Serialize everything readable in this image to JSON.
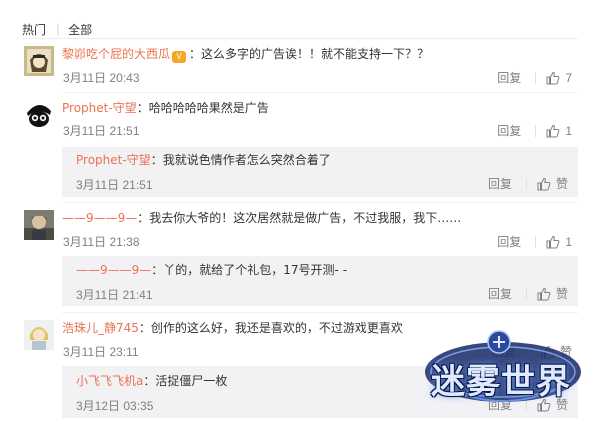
{
  "tabs": {
    "hot": "热门",
    "all": "全部"
  },
  "actions": {
    "reply": "回复",
    "like": "赞"
  },
  "comments": [
    {
      "user": "黎峁吃个屁的大西瓜",
      "text": "：这么多字的广告诶！！就不能支持一下？？",
      "time": "3月11日 20:43",
      "likes": "7"
    },
    {
      "user": "Prophet-守望",
      "text": "：哈哈哈哈哈果然是广告",
      "time": "3月11日 21:51",
      "likes": "1",
      "reply": {
        "user": "Prophet-守望",
        "text": "：我就说色情作者怎么突然合着了",
        "time": "3月11日 21:51"
      }
    },
    {
      "user": "——9——9—",
      "text": "：我去你大爷的！这次居然就是做广告，不过我服，我下……",
      "time": "3月11日 21:38",
      "likes": "1",
      "reply": {
        "user": "——9——9—",
        "text": "：丫的，就给了个礼包，17号开测- -",
        "time": "3月11日 21:41"
      }
    },
    {
      "user": "浩珠儿_静745",
      "text": "：创作的这么好，我还是喜欢的，不过游戏更喜欢",
      "time": "3月11日 23:11",
      "reply": {
        "user": "小飞飞飞机a",
        "text": "：活捉僵尸一枚",
        "time": "3月12日 03:35"
      }
    }
  ],
  "watermark": {
    "text": "迷雾世界"
  },
  "colors": {
    "username": "#eb7350",
    "reply_bg": "#f2f2f5",
    "meta": "#808080"
  }
}
